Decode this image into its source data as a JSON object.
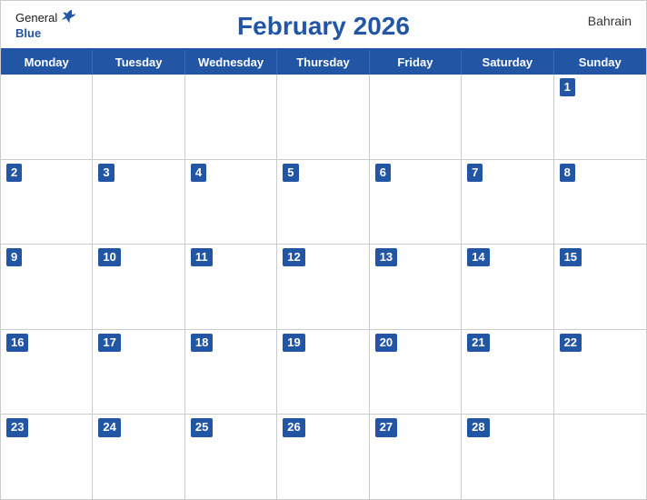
{
  "header": {
    "title": "February 2026",
    "country": "Bahrain",
    "logo_general": "General",
    "logo_blue": "Blue"
  },
  "days_of_week": [
    "Monday",
    "Tuesday",
    "Wednesday",
    "Thursday",
    "Friday",
    "Saturday",
    "Sunday"
  ],
  "weeks": [
    [
      null,
      null,
      null,
      null,
      null,
      null,
      1
    ],
    [
      2,
      3,
      4,
      5,
      6,
      7,
      8
    ],
    [
      9,
      10,
      11,
      12,
      13,
      14,
      15
    ],
    [
      16,
      17,
      18,
      19,
      20,
      21,
      22
    ],
    [
      23,
      24,
      25,
      26,
      27,
      28,
      null
    ]
  ]
}
